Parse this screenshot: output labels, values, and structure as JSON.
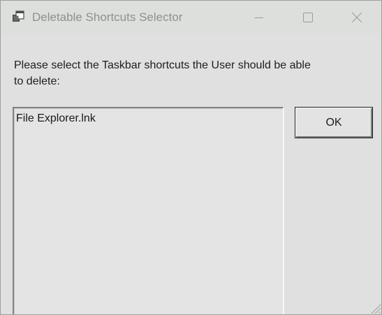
{
  "window": {
    "title": "Deletable Shortcuts Selector",
    "icon": "app-window-icon"
  },
  "caption_buttons": {
    "minimize_icon": "minimize-icon",
    "maximize_icon": "maximize-icon",
    "close_icon": "close-icon"
  },
  "content": {
    "prompt": "Please select the Taskbar shortcuts the User should be able to delete:",
    "list_items": [
      "File Explorer.lnk"
    ],
    "ok_label": "OK"
  },
  "colors": {
    "window_background": "#dfe0df",
    "title_text": "#8e8f8e",
    "text": "#1e1e1e",
    "button_border": "#1b1b1b"
  }
}
